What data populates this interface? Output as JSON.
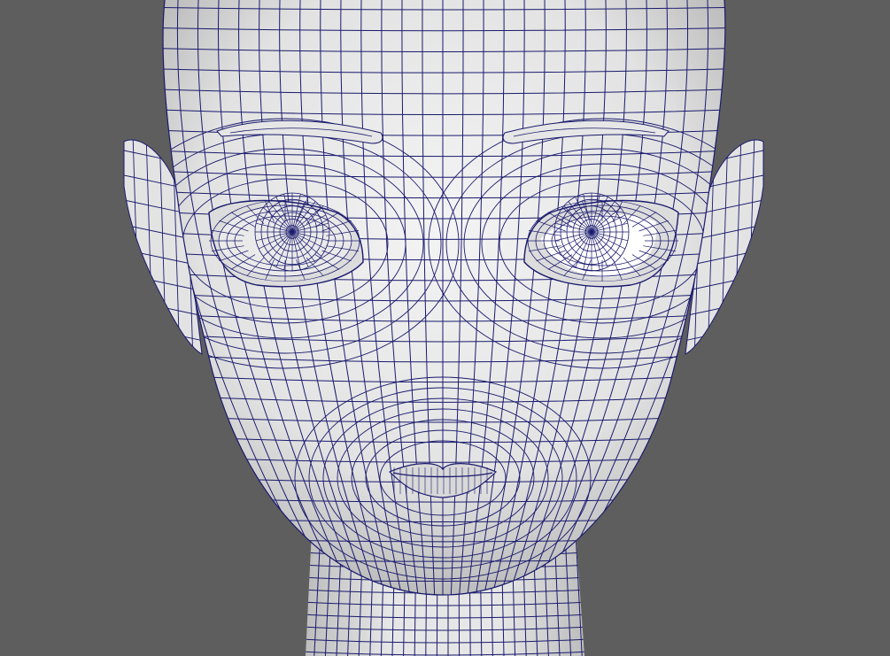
{
  "viewport": {
    "background_color": "#5e5e5e",
    "mesh_fill_color": "#ececec",
    "mesh_shade_color": "#bdbdbd",
    "wire_color": "#1a1a6e",
    "eye_white_color": "#ffffff",
    "icon": "3d-wireframe-head-model"
  }
}
